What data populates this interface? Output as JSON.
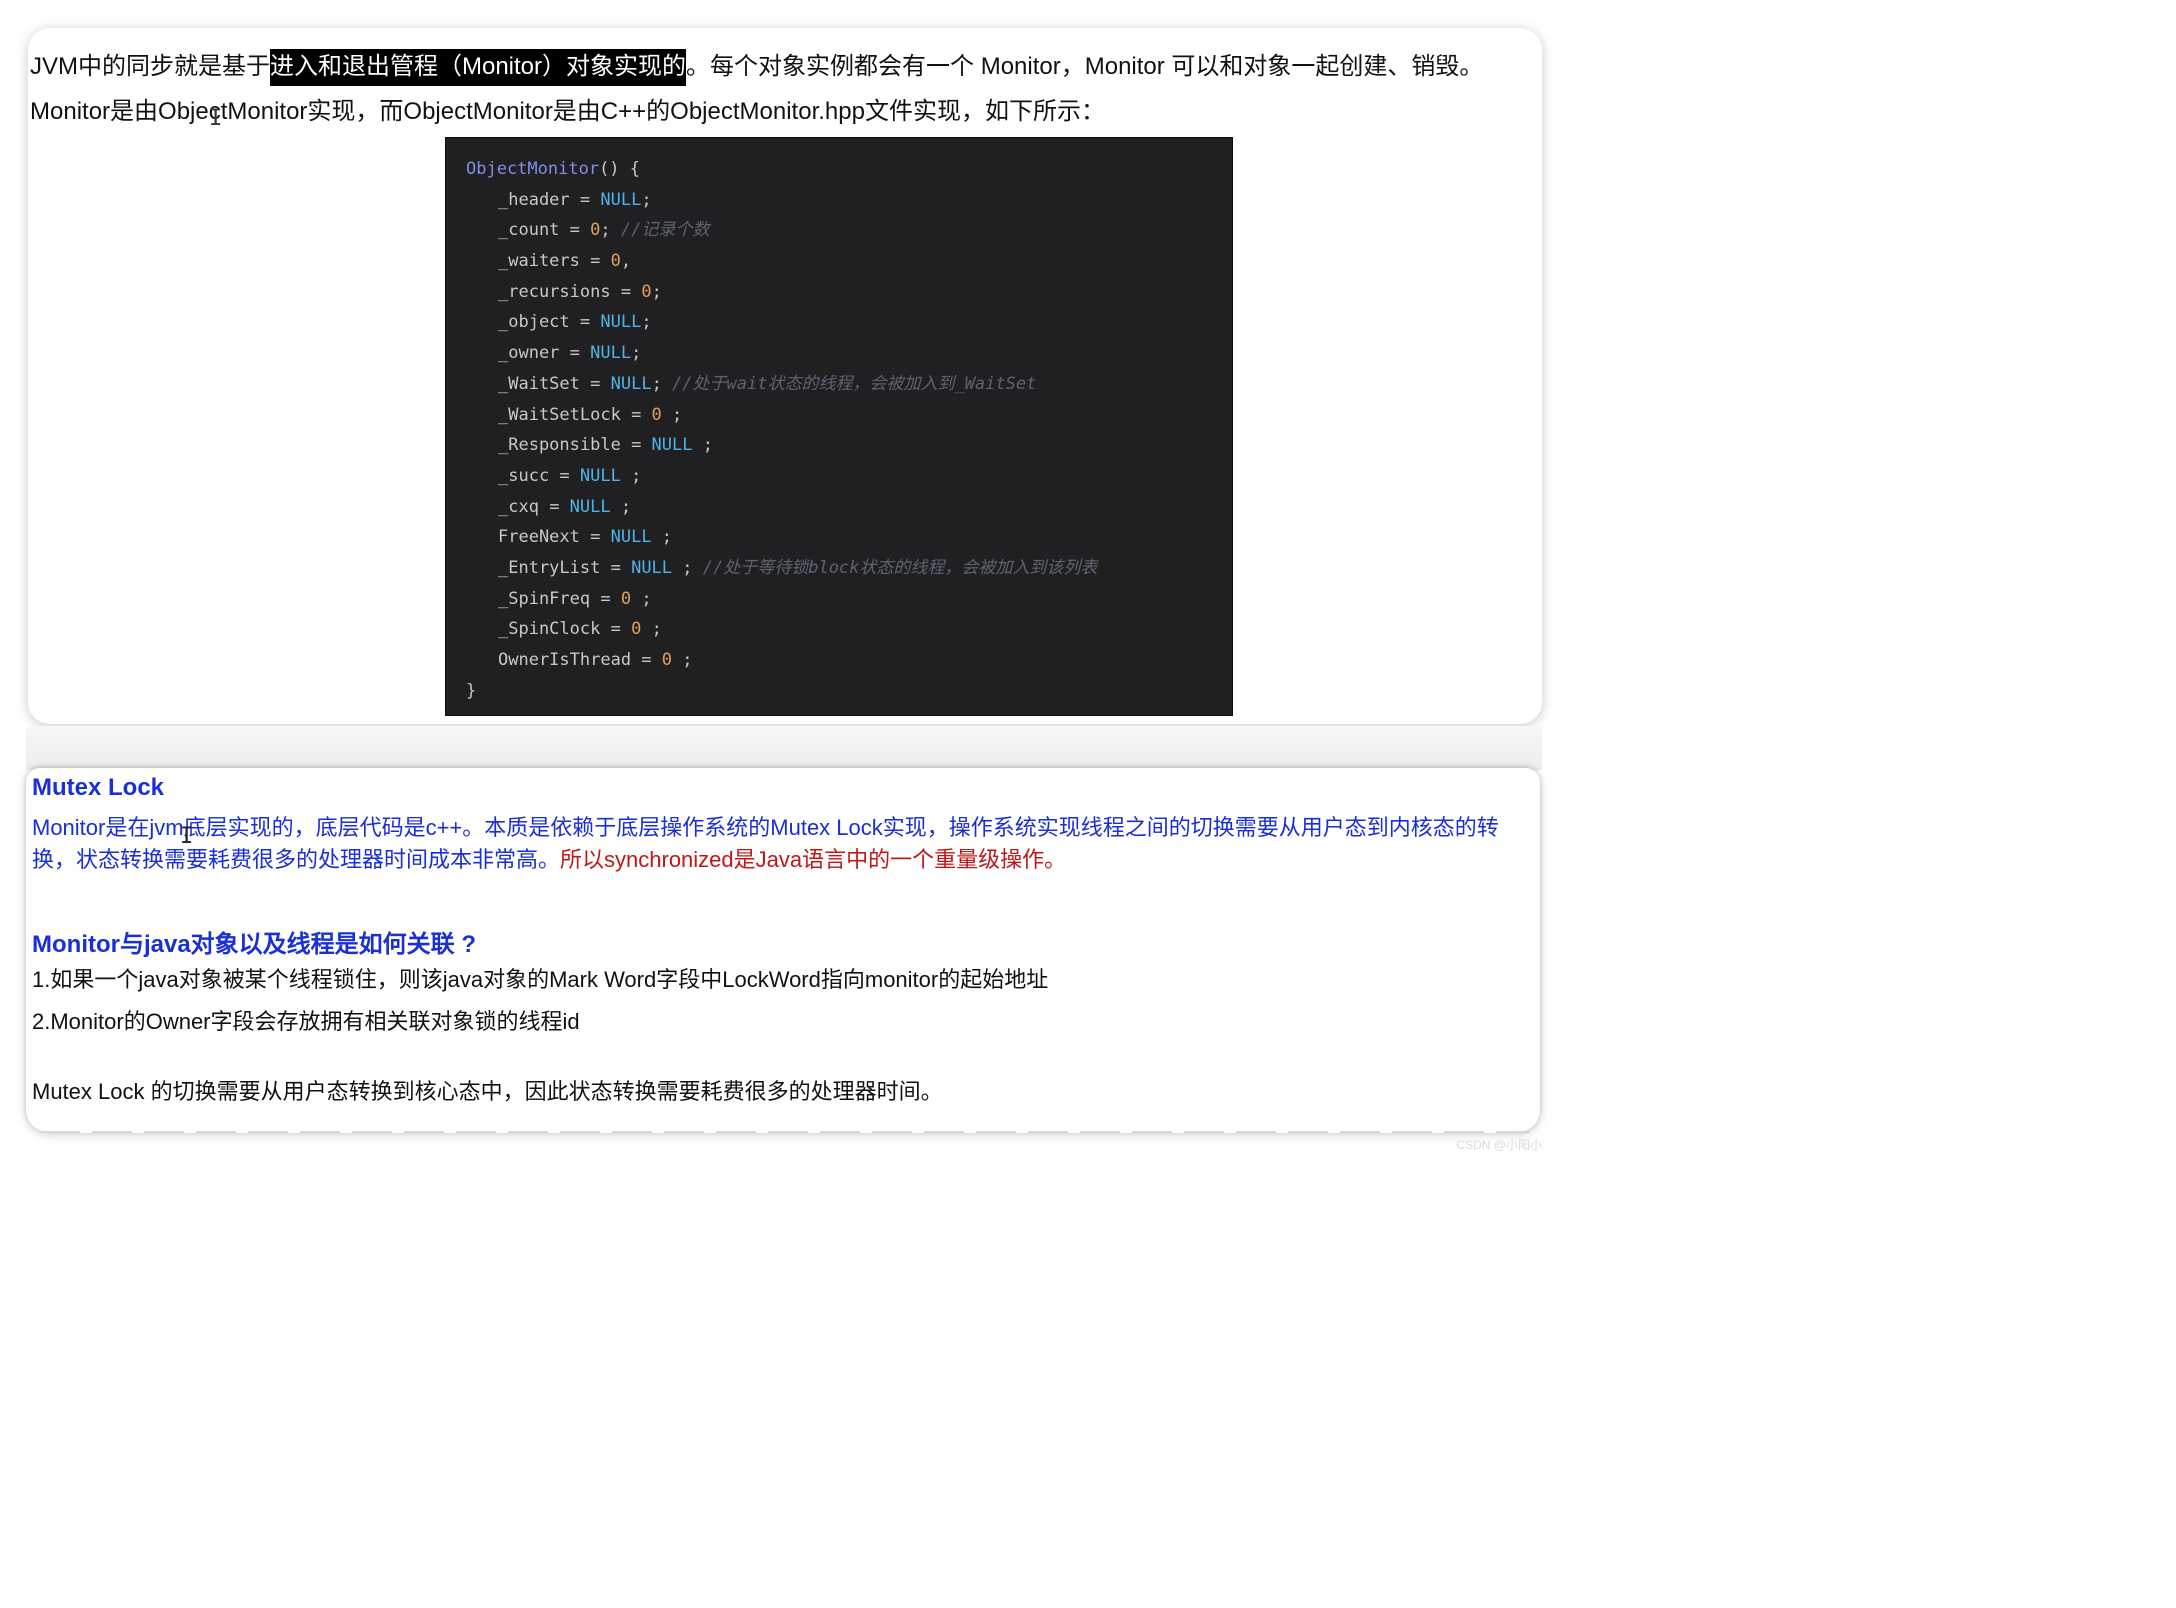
{
  "intro": {
    "line1_start": "JVM中的同步就是基于",
    "line1_highlight": "进入和退出管程（Monitor）对象实现的",
    "line1_end": "。每个对象实例都会有一个 Monitor，Monitor 可以和对象一起创建、销毁。",
    "line2": "Monitor是由ObjectMonitor实现，而ObjectMonitor是由C++的ObjectMonitor.hpp文件实现，如下所示："
  },
  "cursor_glyph": "I",
  "code": {
    "open_fn": "ObjectMonitor",
    "open_rest": "() {",
    "lines": [
      {
        "name": "_header",
        "op": " = ",
        "value": "NULL",
        "kind": "const",
        "end": ";",
        "comment": ""
      },
      {
        "name": "_count",
        "op": " = ",
        "value": "0",
        "kind": "num",
        "end": "; ",
        "comment": "//记录个数"
      },
      {
        "name": "_waiters",
        "op": " = ",
        "value": "0",
        "kind": "num",
        "end": ",",
        "comment": ""
      },
      {
        "name": "_recursions",
        "op": " = ",
        "value": "0",
        "kind": "num",
        "end": ";",
        "comment": ""
      },
      {
        "name": "_object",
        "op": " = ",
        "value": "NULL",
        "kind": "const",
        "end": ";",
        "comment": ""
      },
      {
        "name": "_owner",
        "op": " = ",
        "value": "NULL",
        "kind": "const",
        "end": ";",
        "comment": ""
      },
      {
        "name": "_WaitSet",
        "op": " = ",
        "value": "NULL",
        "kind": "const",
        "end": "; ",
        "comment": "//处于wait状态的线程，会被加入到_WaitSet"
      },
      {
        "name": "_WaitSetLock",
        "op": " = ",
        "value": "0",
        "kind": "num",
        "end": " ;",
        "comment": ""
      },
      {
        "name": "_Responsible",
        "op": " = ",
        "value": "NULL",
        "kind": "const",
        "end": " ;",
        "comment": ""
      },
      {
        "name": "_succ",
        "op": " = ",
        "value": "NULL",
        "kind": "const",
        "end": " ;",
        "comment": ""
      },
      {
        "name": "_cxq",
        "op": " = ",
        "value": "NULL",
        "kind": "const",
        "end": " ;",
        "comment": ""
      },
      {
        "name": "FreeNext",
        "op": " = ",
        "value": "NULL",
        "kind": "const",
        "end": " ;",
        "comment": ""
      },
      {
        "name": "_EntryList",
        "op": " = ",
        "value": "NULL",
        "kind": "const",
        "end": " ; ",
        "comment": "//处于等待锁block状态的线程，会被加入到该列表"
      },
      {
        "name": "_SpinFreq",
        "op": " = ",
        "value": "0",
        "kind": "num",
        "end": " ;",
        "comment": ""
      },
      {
        "name": "_SpinClock",
        "op": " = ",
        "value": "0",
        "kind": "num",
        "end": " ;",
        "comment": ""
      },
      {
        "name": "OwnerIsThread",
        "op": " = ",
        "value": "0",
        "kind": "num",
        "end": " ;",
        "comment": ""
      }
    ],
    "close": "}"
  },
  "mutex": {
    "heading": "Mutex Lock",
    "para_blue_1": "Monitor是在jvm底层实现的，底层代码是c++。本质是依赖于底层操作系统的Mutex Lock实现，操作系统实现线程之间的切换需要从用户态到内核态的转换，状态转换需要耗费很多的处理器时间成本非常高。",
    "para_red": "所以synchronized是Java语言中的一个重量级操作。"
  },
  "relation": {
    "heading": "Monitor与java对象以及线程是如何关联 ?",
    "item1": "1.如果一个java对象被某个线程锁住，则该java对象的Mark Word字段中LockWord指向monitor的起始地址",
    "item2": "2.Monitor的Owner字段会存放拥有相关联对象锁的线程id",
    "summary": "Mutex Lock 的切换需要从用户态转换到核心态中，因此状态转换需要耗费很多的处理器时间。"
  },
  "watermark": "CSDN @小阳小"
}
